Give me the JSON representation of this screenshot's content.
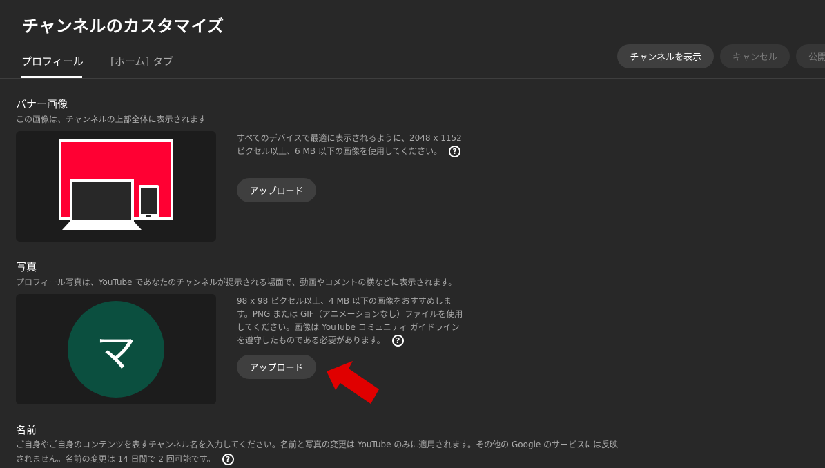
{
  "header": {
    "title": "チャンネルのカスタマイズ",
    "tabs": [
      {
        "label": "プロフィール",
        "active": true
      },
      {
        "label": "[ホーム] タブ",
        "active": false
      }
    ],
    "actions": {
      "view_channel": "チャンネルを表示",
      "cancel": "キャンセル",
      "publish": "公開"
    }
  },
  "banner": {
    "title": "バナー画像",
    "description": "この画像は、チャンネルの上部全体に表示されます",
    "info": "すべてのデバイスで最適に表示されるように、2048 x 1152 ピクセル以上、6 MB 以下の画像を使用してください。",
    "upload_label": "アップロード"
  },
  "photo": {
    "title": "写真",
    "description": "プロフィール写真は、YouTube であなたのチャンネルが提示される場面で、動画やコメントの横などに表示されます。",
    "info": "98 x 98 ピクセル以上、4 MB 以下の画像をおすすめします。PNG または GIF（アニメーションなし）ファイルを使用してください。画像は YouTube コミュニティ ガイドラインを遵守したものである必要があります。",
    "upload_label": "アップロード",
    "avatar_letter": "マ",
    "avatar_color": "#0b4f3f"
  },
  "name": {
    "title": "名前",
    "description": "ご自身やご自身のコンテンツを表すチャンネル名を入力してください。名前と写真の変更は YouTube のみに適用されます。その他の Google のサービスには反映されません。名前の変更は 14 日間で 2 回可能です。"
  },
  "icons": {
    "help": "help-icon",
    "arrow": "arrow-pointer-icon"
  },
  "colors": {
    "background": "#282828",
    "banner_red": "#ff0033",
    "arrow_red": "#e00000"
  }
}
